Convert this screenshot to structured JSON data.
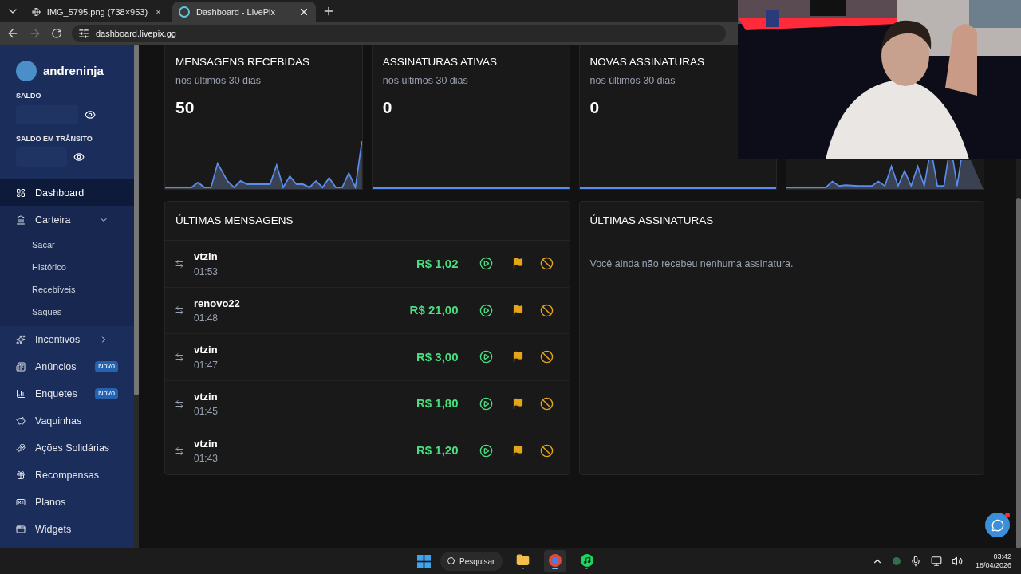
{
  "browser": {
    "tabs": [
      {
        "title": "IMG_5795.png (738×953)",
        "selected": false
      },
      {
        "title": "Dashboard - LivePix",
        "selected": true
      }
    ],
    "url": "dashboard.livepix.gg"
  },
  "sidebar": {
    "username": "andreninja",
    "balances": [
      {
        "label": "SALDO"
      },
      {
        "label": "SALDO EM TRÂNSITO"
      }
    ],
    "items": [
      {
        "label": "Dashboard",
        "selected": true
      },
      {
        "label": "Carteira",
        "selected": false,
        "expanded": true,
        "children": [
          {
            "label": "Sacar"
          },
          {
            "label": "Histórico"
          },
          {
            "label": "Recebíveis"
          },
          {
            "label": "Saques"
          }
        ]
      },
      {
        "label": "Incentivos",
        "selected": false,
        "expanded": false
      },
      {
        "label": "Anúncios",
        "selected": false,
        "badge": "Novo"
      },
      {
        "label": "Enquetes",
        "selected": false,
        "badge": "Novo"
      },
      {
        "label": "Vaquinhas",
        "selected": false
      },
      {
        "label": "Ações Solidárias",
        "selected": false
      },
      {
        "label": "Recompensas",
        "selected": false
      },
      {
        "label": "Planos",
        "selected": false
      },
      {
        "label": "Widgets",
        "selected": false
      }
    ]
  },
  "stats": [
    {
      "title": "MENSAGENS RECEBIDAS",
      "subtitle": "nos últimos 30 dias",
      "value": "50"
    },
    {
      "title": "ASSINATURAS ATIVAS",
      "subtitle": "nos últimos 30 dias",
      "value": "0"
    },
    {
      "title": "NOVAS ASSINATURAS",
      "subtitle": "nos últimos 30 dias",
      "value": "0"
    }
  ],
  "messages": {
    "title": "ÚLTIMAS MENSAGENS",
    "rows": [
      {
        "name": "vtzin",
        "time": "01:53",
        "amount": "R$ 1,02"
      },
      {
        "name": "renovo22",
        "time": "01:48",
        "amount": "R$ 21,00"
      },
      {
        "name": "vtzin",
        "time": "01:47",
        "amount": "R$ 3,00"
      },
      {
        "name": "vtzin",
        "time": "01:45",
        "amount": "R$ 1,80"
      },
      {
        "name": "vtzin",
        "time": "01:43",
        "amount": "R$ 1,20"
      }
    ]
  },
  "subscriptions": {
    "title": "ÚLTIMAS ASSINATURAS",
    "empty_message": "Você ainda não recebeu nenhuma assinatura."
  },
  "taskbar": {
    "search": "Pesquisar",
    "apps": [
      {
        "selected": false
      },
      {
        "selected": true
      },
      {
        "selected": false
      }
    ],
    "time": "03:42",
    "date": "18/04/2026"
  }
}
